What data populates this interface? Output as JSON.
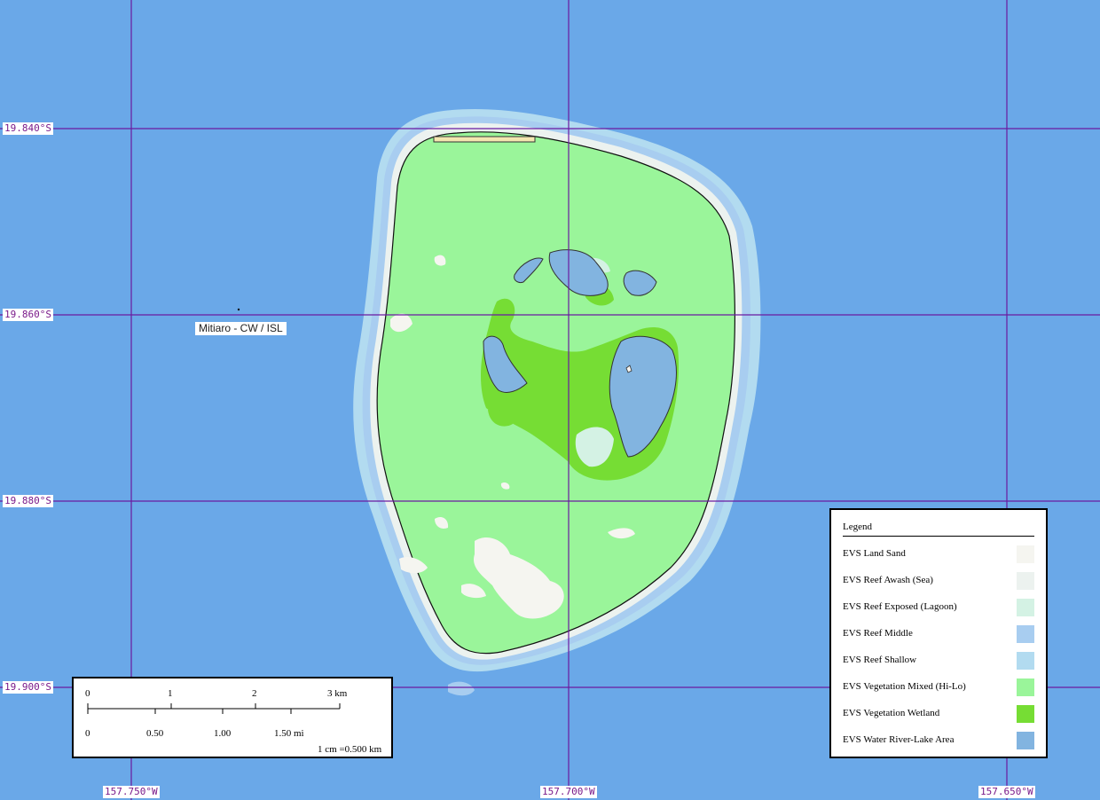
{
  "map": {
    "place_name": "Mitiaro - CW / ISL",
    "colors": {
      "ocean": "#6aa8e8",
      "grid_line": "#6a1aa0",
      "land_sand": "#f5f5f0",
      "reef_awash": "#ecf2ef",
      "reef_exposed": "#d4f2e4",
      "reef_middle": "#a8cdf0",
      "reef_shallow": "#b2dbf0",
      "vegetation_mixed": "#9af59a",
      "vegetation_wetland": "#76dd34",
      "water_river_lake": "#82b4e0"
    }
  },
  "grid": {
    "latitudes": [
      "19.840°S",
      "19.860°S",
      "19.880°S",
      "19.900°S"
    ],
    "longitudes": [
      "157.750°W",
      "157.700°W",
      "157.650°W"
    ]
  },
  "scale_bar": {
    "km_ticks": [
      "0",
      "1",
      "2",
      "3 km"
    ],
    "mi_ticks": [
      "0",
      "0.50",
      "1.00",
      "1.50 mi"
    ],
    "ratio": "1 cm =0.500 km"
  },
  "legend": {
    "title": "Legend",
    "items": [
      {
        "label": "EVS Land Sand",
        "color": "#f5f5f0"
      },
      {
        "label": "EVS Reef Awash (Sea)",
        "color": "#ecf2ef"
      },
      {
        "label": "EVS Reef Exposed (Lagoon)",
        "color": "#d4f2e4"
      },
      {
        "label": "EVS Reef Middle",
        "color": "#a8cdf0"
      },
      {
        "label": "EVS Reef Shallow",
        "color": "#b2dbf0"
      },
      {
        "label": "EVS Vegetation Mixed (Hi-Lo)",
        "color": "#9af59a"
      },
      {
        "label": "EVS Vegetation Wetland",
        "color": "#76dd34"
      },
      {
        "label": "EVS Water River-Lake Area",
        "color": "#82b4e0"
      }
    ]
  }
}
